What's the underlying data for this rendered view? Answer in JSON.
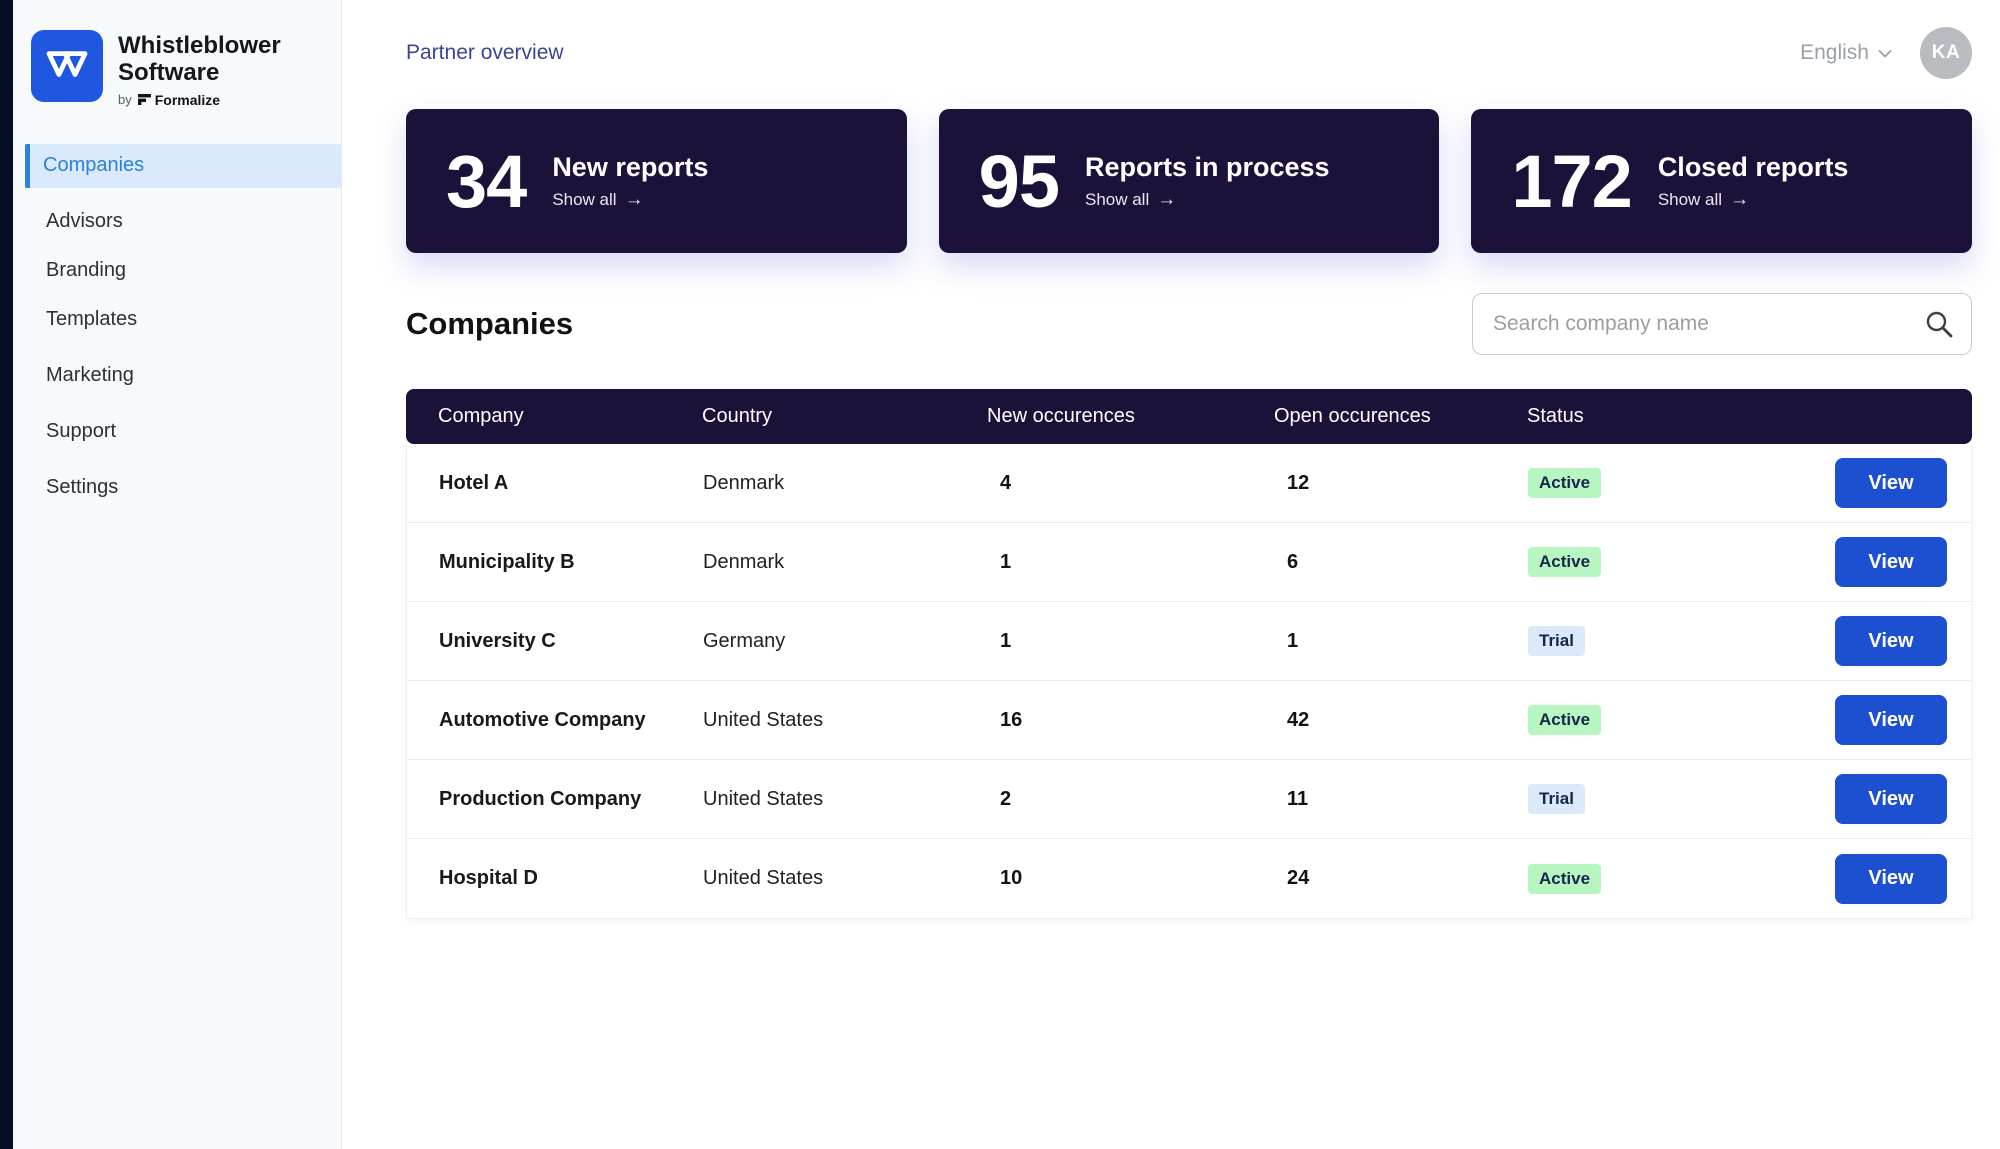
{
  "brand": {
    "name_line1": "Whistleblower",
    "name_line2": "Software",
    "by_label": "by",
    "formalize_label": "Formalize"
  },
  "sidebar": {
    "items": [
      {
        "label": "Companies",
        "active": true
      },
      {
        "label": "Advisors",
        "active": false
      },
      {
        "label": "Branding",
        "active": false
      },
      {
        "label": "Templates",
        "active": false
      },
      {
        "label": "Marketing",
        "active": false
      },
      {
        "label": "Support",
        "active": false
      },
      {
        "label": "Settings",
        "active": false
      }
    ]
  },
  "topbar": {
    "breadcrumb": "Partner overview",
    "language": "English",
    "avatar_initials": "KA"
  },
  "stats": [
    {
      "value": "34",
      "label": "New reports",
      "link": "Show all"
    },
    {
      "value": "95",
      "label": "Reports in process",
      "link": "Show all"
    },
    {
      "value": "172",
      "label": "Closed reports",
      "link": "Show all"
    }
  ],
  "companies_section": {
    "title": "Companies",
    "search_placeholder": "Search company name"
  },
  "table": {
    "columns": [
      "Company",
      "Country",
      "New occurences",
      "Open occurences",
      "Status"
    ],
    "action_label": "View",
    "rows": [
      {
        "company": "Hotel A",
        "country": "Denmark",
        "new_occurences": "4",
        "open_occurences": "12",
        "status": "Active"
      },
      {
        "company": "Municipality B",
        "country": "Denmark",
        "new_occurences": "1",
        "open_occurences": "6",
        "status": "Active"
      },
      {
        "company": "University C",
        "country": "Germany",
        "new_occurences": "1",
        "open_occurences": "1",
        "status": "Trial"
      },
      {
        "company": "Automotive Company",
        "country": "United States",
        "new_occurences": "16",
        "open_occurences": "42",
        "status": "Active"
      },
      {
        "company": "Production Company",
        "country": "United States",
        "new_occurences": "2",
        "open_occurences": "11",
        "status": "Trial"
      },
      {
        "company": "Hospital D",
        "country": "United States",
        "new_occurences": "10",
        "open_occurences": "24",
        "status": "Active"
      }
    ]
  },
  "colors": {
    "navy": "#1b1139",
    "button_blue": "#1d4fd1",
    "logo_blue": "#2057e0",
    "sidebar_active_text": "#2f80d7",
    "sidebar_active_bg": "#d9eafc",
    "active_badge_bg": "#b7f5c1",
    "trial_badge_bg": "#dce9fb",
    "breadcrumb_text": "#3c4499"
  }
}
